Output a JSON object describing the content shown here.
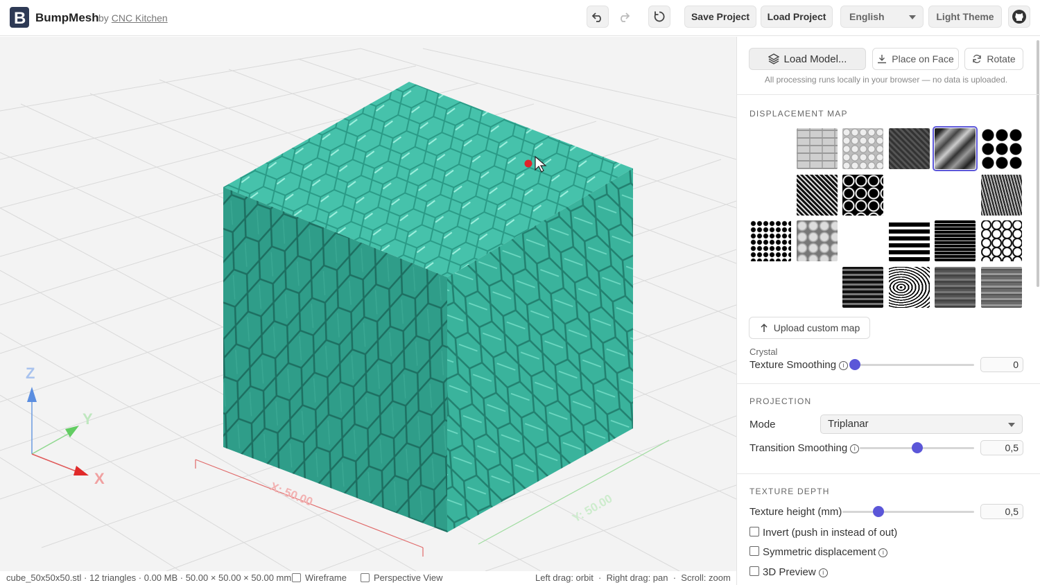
{
  "header": {
    "app_name": "BumpMesh",
    "by": "by",
    "by_link": "CNC Kitchen",
    "save_project": "Save Project",
    "load_project": "Load Project",
    "language": "English",
    "theme": "Light Theme"
  },
  "viewport": {
    "axes": {
      "z": "Z",
      "y": "Y",
      "x": "X"
    },
    "dims": {
      "x": "X: 50.00",
      "y": "Y: 50.00"
    },
    "model_color": "#3fb9a3"
  },
  "status": {
    "file_info": "cube_50x50x50.stl · 12 triangles · 0.00 MB · 50.00 × 50.00 × 50.00 mm",
    "wireframe": "Wireframe",
    "perspective": "Perspective View",
    "help": "Left drag: orbit  ·  Right drag: pan  ·  Scroll: zoom"
  },
  "panel": {
    "load_model": "Load Model...",
    "place_on_face": "Place on Face",
    "rotate": "Rotate",
    "privacy": "All processing runs locally in your browser — no data is uploaded.",
    "displacement": {
      "title": "DISPLACEMENT MAP",
      "upload": "Upload custom map",
      "selected_name": "Crystal",
      "smoothing_label": "Texture Smoothing",
      "smoothing_value": "0",
      "textures": [
        "grid-bricks",
        "bricks",
        "circles",
        "carbon",
        "crystal",
        "dots",
        "fine-grid",
        "diagonal-weave",
        "hexagons",
        "camo",
        "triangles",
        "knit",
        "diamonds",
        "cells",
        "noise",
        "stripes-wide",
        "stripes-fine",
        "voronoi",
        "zigzag",
        "basket-weave",
        "leather-weave",
        "wood-grain",
        "wood-dark",
        "wood-grey"
      ],
      "selected_index": 4
    },
    "projection": {
      "title": "PROJECTION",
      "mode_label": "Mode",
      "mode_value": "Triplanar",
      "transition_label": "Transition Smoothing",
      "transition_value": "0,5"
    },
    "depth": {
      "title": "TEXTURE DEPTH",
      "height_label": "Texture height (mm)",
      "height_value": "0,5",
      "invert": "Invert (push in instead of out)",
      "symmetric": "Symmetric displacement",
      "preview3d": "3D Preview"
    },
    "accent_color": "#5b56d8"
  }
}
